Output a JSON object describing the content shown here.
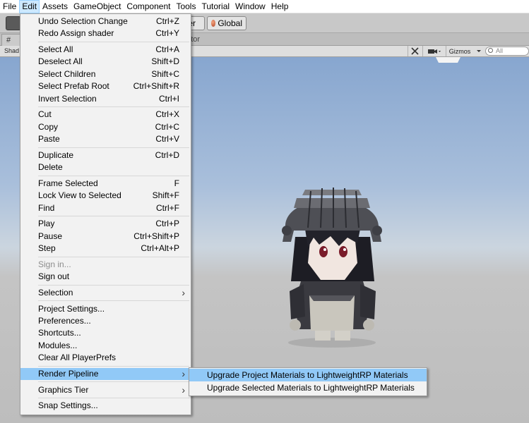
{
  "menubar": {
    "items": [
      "File",
      "Edit",
      "Assets",
      "GameObject",
      "Component",
      "Tools",
      "Tutorial",
      "Window",
      "Help"
    ],
    "active": "Edit"
  },
  "toolbar": {
    "pivot_partial": "ter",
    "global_label": "Global"
  },
  "tabs": {
    "scene_partial": "S",
    "animator_partial": "nator"
  },
  "scene_toolbar": {
    "shading_partial": "Shad",
    "gizmos_label": "Gizmos",
    "search_placeholder": "All"
  },
  "edit_menu": {
    "groups": [
      [
        {
          "label": "Undo Selection Change",
          "shortcut": "Ctrl+Z"
        },
        {
          "label": "Redo Assign shader",
          "shortcut": "Ctrl+Y"
        }
      ],
      [
        {
          "label": "Select All",
          "shortcut": "Ctrl+A"
        },
        {
          "label": "Deselect All",
          "shortcut": "Shift+D"
        },
        {
          "label": "Select Children",
          "shortcut": "Shift+C"
        },
        {
          "label": "Select Prefab Root",
          "shortcut": "Ctrl+Shift+R"
        },
        {
          "label": "Invert Selection",
          "shortcut": "Ctrl+I"
        }
      ],
      [
        {
          "label": "Cut",
          "shortcut": "Ctrl+X"
        },
        {
          "label": "Copy",
          "shortcut": "Ctrl+C"
        },
        {
          "label": "Paste",
          "shortcut": "Ctrl+V"
        }
      ],
      [
        {
          "label": "Duplicate",
          "shortcut": "Ctrl+D"
        },
        {
          "label": "Delete",
          "shortcut": ""
        }
      ],
      [
        {
          "label": "Frame Selected",
          "shortcut": "F"
        },
        {
          "label": "Lock View to Selected",
          "shortcut": "Shift+F"
        },
        {
          "label": "Find",
          "shortcut": "Ctrl+F"
        }
      ],
      [
        {
          "label": "Play",
          "shortcut": "Ctrl+P"
        },
        {
          "label": "Pause",
          "shortcut": "Ctrl+Shift+P"
        },
        {
          "label": "Step",
          "shortcut": "Ctrl+Alt+P"
        }
      ],
      [
        {
          "label": "Sign in...",
          "shortcut": "",
          "disabled": true
        },
        {
          "label": "Sign out",
          "shortcut": ""
        }
      ],
      [
        {
          "label": "Selection",
          "shortcut": "",
          "submenu": true
        }
      ],
      [
        {
          "label": "Project Settings...",
          "shortcut": ""
        },
        {
          "label": "Preferences...",
          "shortcut": ""
        },
        {
          "label": "Shortcuts...",
          "shortcut": ""
        },
        {
          "label": "Modules...",
          "shortcut": ""
        },
        {
          "label": "Clear All PlayerPrefs",
          "shortcut": ""
        }
      ],
      [
        {
          "label": "Render Pipeline",
          "shortcut": "",
          "submenu": true,
          "highlighted": true
        }
      ],
      [
        {
          "label": "Graphics Tier",
          "shortcut": "",
          "submenu": true
        }
      ],
      [
        {
          "label": "Snap Settings...",
          "shortcut": ""
        }
      ]
    ]
  },
  "render_pipeline_submenu": {
    "items": [
      {
        "label": "Upgrade Project Materials to LightweightRP Materials",
        "highlighted": true
      },
      {
        "label": "Upgrade Selected Materials to LightweightRP Materials",
        "highlighted": false
      }
    ]
  },
  "colors": {
    "menu_highlight": "#91c9f7",
    "menubar_active": "#cce8ff",
    "sky_top": "#87a6cf",
    "ground": "#bdbdbd"
  }
}
